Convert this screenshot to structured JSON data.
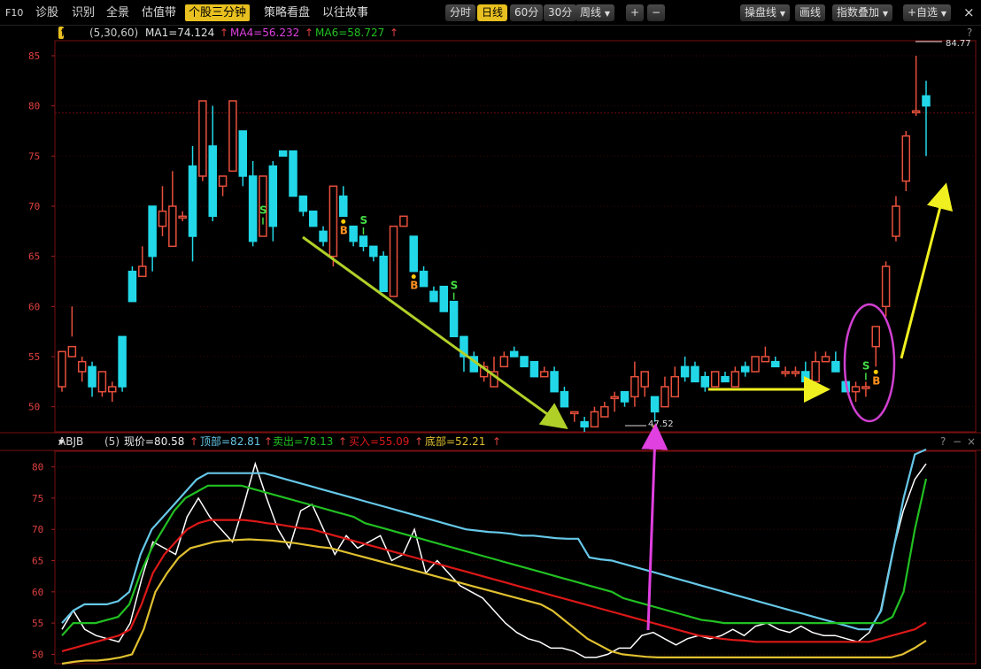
{
  "toolbar": {
    "f10": "F10",
    "items": [
      "诊股",
      "识别",
      "全景",
      "估值带",
      "个股三分钟",
      "策略看盘",
      "以往故事"
    ],
    "active_item": "个股三分钟",
    "periods": [
      "分时",
      "日线",
      "60分",
      "30分",
      "周线"
    ],
    "active_period": "日线",
    "zoom_in": "+",
    "zoom_out": "−",
    "right_items": [
      "操盘线",
      "画线",
      "指数叠加",
      "+自选"
    ],
    "close": "×"
  },
  "ma_header": {
    "selector": "MA",
    "params": "(5,30,60)",
    "ma1": "MA1=74.124",
    "ma4": "MA4=56.232",
    "ma6": "MA6=58.727",
    "help": "?"
  },
  "indicator_header": {
    "name": "ABJB",
    "param": "(5)",
    "now": "现价=80.58",
    "top": "顶部=82.81",
    "sell": "卖出=78.13",
    "buy": "买入=55.09",
    "bottom": "底部=52.21",
    "help": "?",
    "minus": "−",
    "close": "×"
  },
  "colors": {
    "up": "#e8503c",
    "down": "#22d8e8",
    "now": "#ffffff",
    "top": "#66c8e8",
    "sell": "#22c022",
    "buy": "#dd1818",
    "bottom": "#e0c030",
    "signal_s": "#44dd44",
    "signal_b": "#ff9020",
    "arrow_down": "#b0d028",
    "arrow_flat": "#f0f020",
    "arrow_up": "#f0f020",
    "arrow_magenta": "#e040e0",
    "circle": "#d040d0"
  },
  "chart_data": [
    {
      "type": "candlestick",
      "y_ticks": [
        50,
        55,
        60,
        65,
        70,
        75,
        80,
        85
      ],
      "ylim": [
        47.5,
        86.5
      ],
      "high_label": "84.77",
      "low_label": "47.52",
      "signals": [
        "S",
        "B"
      ],
      "candles": [
        [
          52,
          55.5,
          51.5,
          52
        ],
        [
          55,
          56,
          57,
          60
        ],
        [
          53.5,
          54.5,
          52.5,
          55
        ],
        [
          54,
          52,
          51,
          54.5
        ],
        [
          51.5,
          53.5,
          51,
          53.5
        ],
        [
          51.5,
          52,
          50.5,
          52.5
        ],
        [
          57,
          52,
          51.5,
          57
        ],
        [
          63.5,
          60.5,
          60.5,
          64
        ],
        [
          63,
          64,
          63.5,
          66
        ],
        [
          70,
          65,
          63.5,
          70
        ],
        [
          68,
          69.5,
          67,
          72
        ],
        [
          66,
          70,
          66,
          73.5
        ],
        [
          69,
          69,
          68.5,
          69.5
        ],
        [
          74,
          67,
          64.5,
          76
        ],
        [
          73,
          80.5,
          72.5,
          80.5
        ],
        [
          76,
          69,
          68.5,
          80
        ],
        [
          72,
          73,
          71,
          72.5
        ],
        [
          73.5,
          80.5,
          73.5,
          80.5
        ],
        [
          77.5,
          73,
          72,
          77
        ],
        [
          73,
          66.5,
          66,
          74.5
        ],
        [
          67,
          73,
          67,
          68
        ],
        [
          74,
          68,
          66.5,
          74.5
        ],
        [
          75.5,
          75,
          75,
          75.5
        ],
        [
          75.5,
          71,
          71,
          75.5
        ],
        [
          71,
          69.5,
          69,
          71
        ],
        [
          69.5,
          68,
          68,
          69.5
        ],
        [
          67.5,
          66.5,
          66,
          68
        ],
        [
          65,
          72,
          64,
          72
        ],
        [
          71,
          69,
          69,
          72
        ],
        [
          68,
          66.5,
          66,
          68
        ],
        [
          67,
          66,
          65.5,
          67
        ],
        [
          66,
          65,
          64.5,
          66
        ],
        [
          65,
          61.5,
          61.5,
          65.5
        ],
        [
          61,
          68,
          61,
          68
        ],
        [
          68,
          69,
          68.5,
          69
        ],
        [
          67,
          63.5,
          63.5,
          67
        ],
        [
          63.5,
          62,
          62,
          64
        ],
        [
          61.5,
          60.5,
          60.5,
          62
        ],
        [
          62,
          59.5,
          59.5,
          62
        ],
        [
          60.5,
          57,
          57,
          60.5
        ],
        [
          57,
          55,
          53.5,
          57
        ],
        [
          55,
          53.5,
          53.5,
          55.5
        ],
        [
          53,
          54,
          52.5,
          54.5
        ],
        [
          52,
          53.5,
          53,
          55
        ],
        [
          54,
          55,
          54,
          55.5
        ],
        [
          55.5,
          55,
          55,
          56
        ],
        [
          55,
          54,
          54,
          55
        ],
        [
          54.5,
          53,
          53,
          54.5
        ],
        [
          53,
          53.5,
          53,
          54
        ],
        [
          53.5,
          51.5,
          51.5,
          54
        ],
        [
          51.5,
          50,
          50,
          52
        ],
        [
          49.5,
          49.5,
          48.5,
          49.5
        ],
        [
          48.5,
          48,
          47.5,
          49
        ],
        [
          48,
          49.5,
          48,
          50
        ],
        [
          49,
          50,
          49,
          50.5
        ],
        [
          51,
          51,
          49.5,
          51.5
        ],
        [
          51.5,
          50.5,
          50,
          51.5
        ],
        [
          51,
          53,
          50,
          54.5
        ],
        [
          52,
          53.5,
          51,
          53
        ],
        [
          51,
          49.5,
          48.5,
          51
        ],
        [
          50,
          52,
          50,
          53
        ],
        [
          51,
          53,
          52,
          54
        ],
        [
          54,
          53,
          52.5,
          55
        ],
        [
          54,
          52.5,
          52.5,
          54.5
        ],
        [
          53,
          52,
          51.5,
          53.5
        ],
        [
          52,
          53.5,
          52,
          53.5
        ],
        [
          53,
          52.5,
          52.5,
          53.5
        ],
        [
          52,
          53.5,
          52,
          54
        ],
        [
          54,
          53.5,
          53,
          54.5
        ],
        [
          53.5,
          55,
          53.5,
          55
        ],
        [
          54.5,
          55,
          54.5,
          56
        ],
        [
          54.5,
          54,
          54,
          55
        ],
        [
          53.5,
          53.5,
          53,
          54
        ],
        [
          53.5,
          53.5,
          53,
          54
        ],
        [
          53.5,
          52.5,
          52.5,
          54.5
        ],
        [
          52.5,
          54.5,
          52.5,
          55.5
        ],
        [
          54.5,
          55,
          54.5,
          55.5
        ],
        [
          54.5,
          53.5,
          53.5,
          55.5
        ],
        [
          52.5,
          51.5,
          51.5,
          53
        ],
        [
          51.5,
          52,
          50.5,
          52.5
        ],
        [
          52,
          52,
          51,
          52.5
        ],
        [
          56,
          58,
          54,
          58
        ],
        [
          60,
          64,
          59,
          64.5
        ],
        [
          67,
          70,
          66.5,
          71
        ],
        [
          72.5,
          77,
          71.5,
          77.5
        ],
        [
          79.5,
          79.5,
          79,
          85
        ],
        [
          81,
          80,
          75,
          82.5
        ]
      ]
    },
    {
      "type": "line",
      "y_ticks": [
        50,
        55,
        60,
        65,
        70,
        75,
        80
      ],
      "ylim": [
        48.5,
        82.5
      ],
      "series": [
        {
          "name": "现价",
          "values": [
            54,
            57,
            54,
            53,
            52.5,
            52,
            55,
            62,
            68,
            67,
            66,
            72,
            75,
            72,
            70,
            68,
            74,
            80.5,
            75,
            70,
            67,
            73,
            74,
            70,
            66,
            69,
            67,
            68,
            69,
            65,
            66,
            70,
            63,
            65,
            63,
            61,
            60,
            59,
            57,
            55,
            53.5,
            52.5,
            52,
            51,
            51,
            50.5,
            49.5,
            49.5,
            50,
            51,
            51,
            53,
            53.5,
            52.5,
            51.5,
            52.5,
            53,
            52.5,
            53,
            54,
            53,
            54.5,
            55,
            54,
            53.5,
            54.5,
            53.5,
            53,
            53,
            52.5,
            52,
            53.5,
            57,
            66,
            73,
            78,
            80.5
          ]
        },
        {
          "name": "顶部",
          "values": [
            55,
            57,
            58,
            58,
            58,
            58.5,
            60,
            66,
            70,
            72,
            74,
            76,
            78,
            79,
            79,
            79,
            79,
            79,
            79,
            78.5,
            78,
            77.5,
            77,
            76.5,
            76,
            75.5,
            75,
            74.5,
            74,
            73.5,
            73,
            72.5,
            72,
            71.5,
            71,
            70.5,
            70,
            69.8,
            69.6,
            69.5,
            69.3,
            69,
            69,
            68.8,
            68.6,
            68.5,
            68.5,
            65.5,
            65.2,
            65,
            64.5,
            64,
            63.5,
            63,
            62.5,
            62,
            61.5,
            61,
            60.5,
            60,
            59.5,
            59,
            58.5,
            58,
            57.5,
            57,
            56.5,
            56,
            55.5,
            55,
            54.5,
            54,
            54,
            57,
            66,
            75,
            82,
            82.8
          ]
        },
        {
          "name": "卖出",
          "values": [
            53,
            55,
            55,
            55,
            55.5,
            56,
            58,
            63,
            67,
            70,
            73,
            75,
            76,
            77,
            77,
            77,
            77,
            76.5,
            76,
            75.5,
            75,
            74.5,
            74,
            73.5,
            73,
            72.5,
            72,
            71,
            70.5,
            70,
            69.5,
            69,
            68.5,
            68,
            67.5,
            67,
            66.5,
            66,
            65.5,
            65,
            64.5,
            64,
            63.5,
            63,
            62.5,
            62,
            61.5,
            61,
            60.5,
            60,
            59,
            58.5,
            58,
            57.5,
            57,
            56.5,
            56,
            55.5,
            55.3,
            55,
            55,
            55,
            55,
            55,
            55,
            55,
            55,
            55,
            55,
            55,
            55,
            55,
            55,
            55,
            56,
            60,
            70,
            78.1
          ]
        },
        {
          "name": "买入",
          "values": [
            50.5,
            51,
            51.5,
            52,
            52.5,
            53,
            54,
            58,
            63,
            66,
            68,
            70,
            71,
            71.5,
            71.5,
            71.5,
            71.5,
            71.3,
            71,
            70.8,
            70.5,
            70.2,
            70,
            69.5,
            69,
            68.5,
            68,
            67.5,
            67,
            66.5,
            66,
            65.5,
            65,
            64.5,
            64,
            63.5,
            63,
            62.5,
            62,
            61.5,
            61,
            60.5,
            60,
            59.5,
            59,
            58.5,
            58,
            57.5,
            57,
            56.5,
            56,
            55.5,
            55,
            54.5,
            54,
            53.5,
            53,
            52.8,
            52.5,
            52.3,
            52.2,
            52,
            52,
            52,
            52,
            52,
            52,
            52,
            52,
            52,
            52,
            52,
            52.5,
            53,
            53.5,
            54,
            55.1
          ]
        },
        {
          "name": "底部",
          "values": [
            48.5,
            48.8,
            49,
            49,
            49.2,
            49.5,
            50,
            54,
            60,
            63,
            65.5,
            67,
            67.5,
            68,
            68.2,
            68.3,
            68.4,
            68.3,
            68.2,
            68,
            67.8,
            67.5,
            67.2,
            67,
            66.5,
            66,
            65.5,
            65,
            64.5,
            64,
            63.5,
            63,
            62.5,
            62,
            61.5,
            61,
            60.5,
            60,
            59.5,
            59,
            58.5,
            58,
            57,
            55.5,
            54,
            52.5,
            51.5,
            50.5,
            50,
            49.8,
            49.6,
            49.5,
            49.5,
            49.5,
            49.5,
            49.5,
            49.5,
            49.5,
            49.5,
            49.5,
            49.5,
            49.5,
            49.5,
            49.5,
            49.5,
            49.5,
            49.5,
            49.5,
            49.5,
            49.5,
            49.5,
            49.5,
            50,
            51,
            52.2
          ]
        }
      ]
    }
  ]
}
